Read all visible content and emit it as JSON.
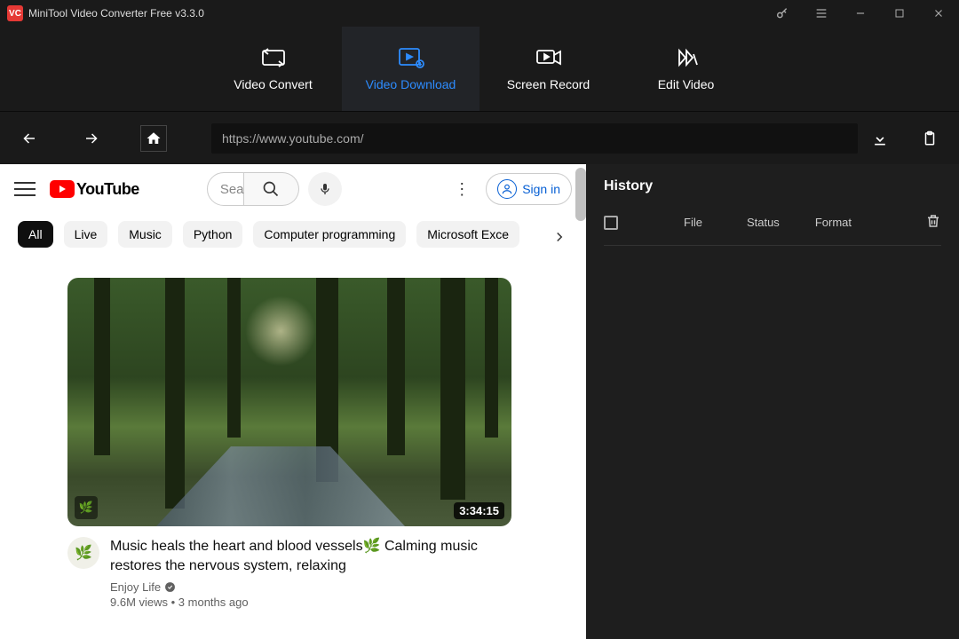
{
  "app": {
    "title": "MiniTool Video Converter Free v3.3.0",
    "icon_text": "VC"
  },
  "tabs": {
    "convert": "Video Convert",
    "download": "Video Download",
    "record": "Screen Record",
    "edit": "Edit Video"
  },
  "nav": {
    "url": "https://www.youtube.com/"
  },
  "youtube": {
    "logo_text": "YouTube",
    "search_placeholder": "Search",
    "search_visible": "Sea",
    "signin": "Sign in",
    "chips": {
      "all": "All",
      "live": "Live",
      "music": "Music",
      "python": "Python",
      "cp": "Computer programming",
      "excel": "Microsoft Exce"
    },
    "video": {
      "duration": "3:34:15",
      "title": "Music heals the heart and blood vessels🌿 Calming music restores the nervous system, relaxing",
      "channel": "Enjoy Life",
      "stats": "9.6M views • 3 months ago"
    }
  },
  "history": {
    "title": "History",
    "cols": {
      "file": "File",
      "status": "Status",
      "format": "Format"
    }
  }
}
